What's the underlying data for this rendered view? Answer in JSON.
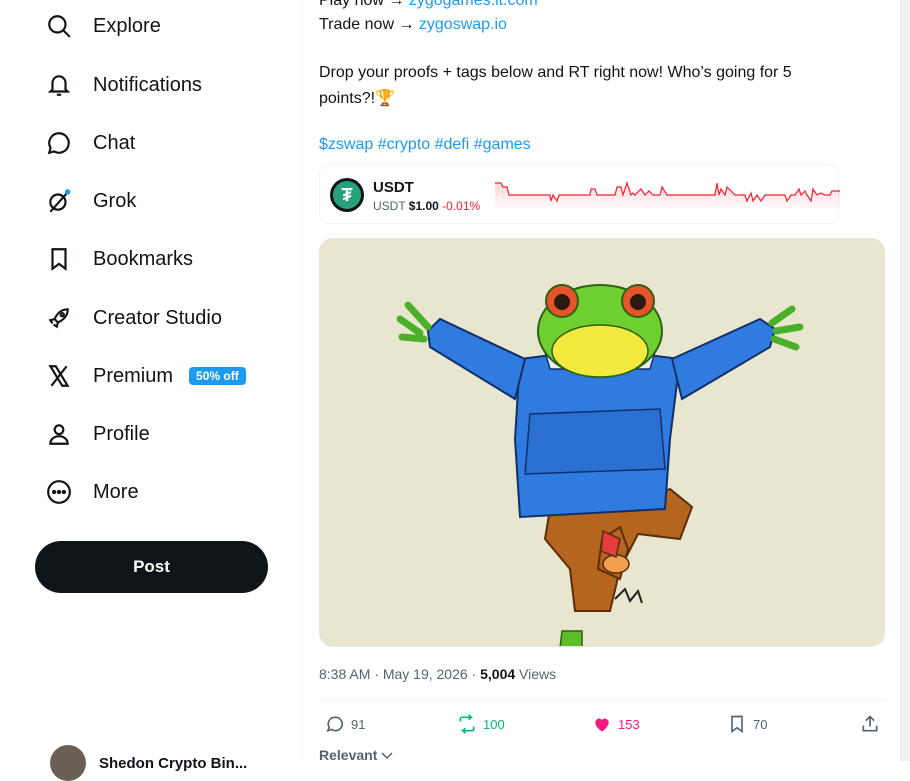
{
  "sidebar": {
    "items": [
      {
        "label": "Explore",
        "icon": "search-icon"
      },
      {
        "label": "Notifications",
        "icon": "bell-icon"
      },
      {
        "label": "Chat",
        "icon": "chat-bubble-icon"
      },
      {
        "label": "Grok",
        "icon": "grok-icon"
      },
      {
        "label": "Bookmarks",
        "icon": "bookmark-icon"
      },
      {
        "label": "Creator Studio",
        "icon": "rocket-icon"
      },
      {
        "label": "Premium",
        "icon": "x-logo-icon",
        "badge": "50% off"
      },
      {
        "label": "Profile",
        "icon": "person-icon"
      },
      {
        "label": "More",
        "icon": "more-circle-icon"
      }
    ],
    "post_label": "Post",
    "account_name": "Shedon Crypto Bin..."
  },
  "post": {
    "line_play_prefix": "Play now → ",
    "line_play_link": "zygogames.it.com",
    "line_trade_prefix": "Trade now → ",
    "line_trade_link": "zygoswap.io",
    "line_drop_1": "Drop your proofs + tags below and RT right now! Who’s going for 5",
    "line_drop_2": "points?!🏆",
    "hashtags": "$zswap #crypto #defi #games",
    "token": {
      "symbol": "USDT",
      "sub_symbol": "USDT",
      "price": "$1.00",
      "change": "-0.01%",
      "color": "#f4212e"
    },
    "meta": {
      "time": "8:38 AM",
      "sep1": " · ",
      "date": "May 19, 2026",
      "sep2": " · ",
      "views_count": "5,004",
      "views_label": " Views"
    },
    "actions": {
      "replies": "91",
      "reposts": "100",
      "likes": "153",
      "bookmarks": "70"
    },
    "sort_label": "Relevant"
  },
  "colors": {
    "accent": "#1d9bf0",
    "repost": "#00ba7c",
    "like": "#f91880",
    "negative": "#f4212e"
  }
}
